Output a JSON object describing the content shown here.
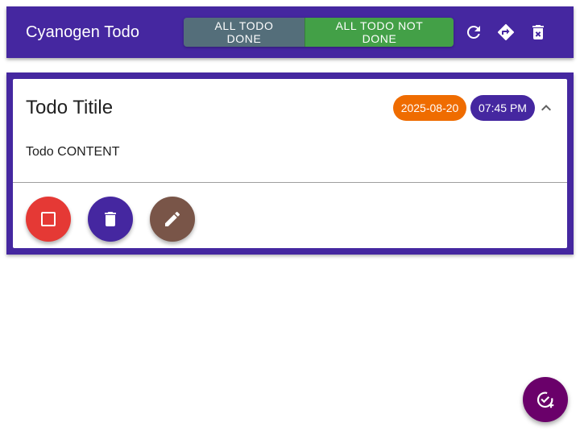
{
  "toolbar": {
    "title": "Cyanogen Todo",
    "all_done_label": "ALL TODO DONE",
    "all_not_done_label": "ALL TODO NOT DONE",
    "icons": [
      "refresh-icon",
      "directions-icon",
      "delete-sweep-icon"
    ]
  },
  "todo": {
    "title": "Todo Titile",
    "date": "2025-08-20",
    "time": "07:45 PM",
    "content": "Todo CONTENT",
    "actions": [
      "checkbox-icon",
      "delete-icon",
      "edit-icon"
    ]
  },
  "fab": {
    "icon": "add-task-icon"
  },
  "colors": {
    "primary": "#4527a0",
    "done_button": "#546e7a",
    "not_done_button": "#43a047",
    "date_chip": "#ef6c00",
    "check_fab": "#e53935",
    "edit_fab": "#795548",
    "add_fab": "#6a006a"
  }
}
